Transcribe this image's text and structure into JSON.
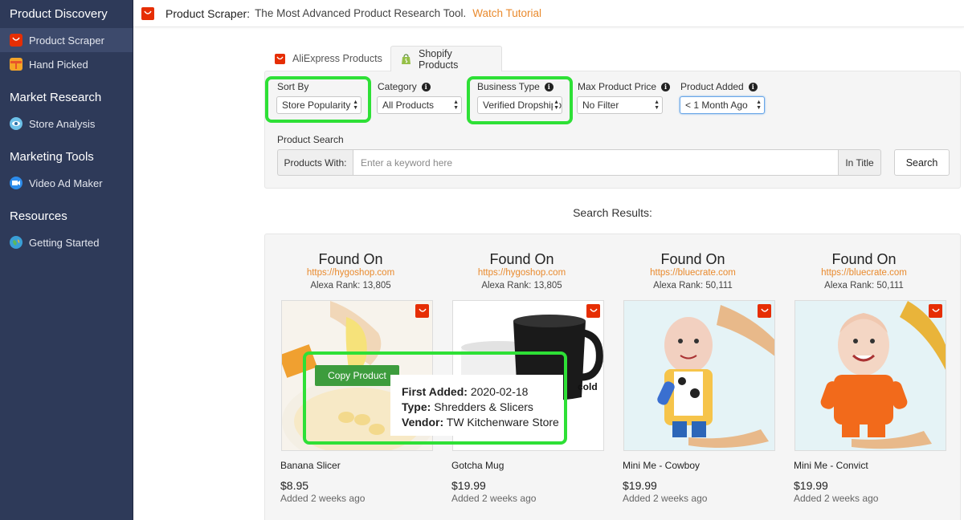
{
  "sidebar": {
    "sections": [
      {
        "heading": "Product Discovery",
        "items": [
          {
            "label": "Product Scraper",
            "icon": "aliexpress-icon",
            "active": true
          },
          {
            "label": "Hand Picked",
            "icon": "gift-icon",
            "active": false
          }
        ]
      },
      {
        "heading": "Market Research",
        "items": [
          {
            "label": "Store Analysis",
            "icon": "eye-icon",
            "active": false
          }
        ]
      },
      {
        "heading": "Marketing Tools",
        "items": [
          {
            "label": "Video Ad Maker",
            "icon": "video-camera-icon",
            "active": false
          }
        ]
      },
      {
        "heading": "Resources",
        "items": [
          {
            "label": "Getting Started",
            "icon": "globe-icon",
            "active": false
          }
        ]
      }
    ]
  },
  "topbar": {
    "title": "Product Scraper:",
    "subtitle": "The Most Advanced Product Research Tool.",
    "tutorial_link": "Watch Tutorial"
  },
  "tabs": [
    {
      "label": "AliExpress Products",
      "icon": "aliexpress-icon",
      "active": false
    },
    {
      "label": "Shopify Products",
      "icon": "shopify-bag-icon",
      "active": true
    }
  ],
  "filters": {
    "sort_by": {
      "label": "Sort By",
      "value": "Store Popularity"
    },
    "category": {
      "label": "Category",
      "value": "All Products"
    },
    "business_type": {
      "label": "Business Type",
      "value": "Verified Dropshippers"
    },
    "max_price": {
      "label": "Max Product Price",
      "value": "No Filter"
    },
    "product_added": {
      "label": "Product Added",
      "value": "< 1 Month Ago"
    }
  },
  "search": {
    "label": "Product Search",
    "prefix": "Products With:",
    "placeholder": "Enter a keyword here",
    "suffix": "In Title",
    "button": "Search"
  },
  "results_label": "Search Results:",
  "results": [
    {
      "found_on": "Found On",
      "url": "https://hygoshop.com",
      "rank": "Alexa Rank: 13,805",
      "name": "Banana Slicer",
      "price": "$8.95",
      "added": "Added 2 weeks ago"
    },
    {
      "found_on": "Found On",
      "url": "https://hygoshop.com",
      "rank": "Alexa Rank: 13,805",
      "name": "Gotcha Mug",
      "price": "$19.99",
      "added": "Added 2 weeks ago"
    },
    {
      "found_on": "Found On",
      "url": "https://bluecrate.com",
      "rank": "Alexa Rank: 50,111",
      "name": "Mini Me - Cowboy",
      "price": "$19.99",
      "added": "Added 2 weeks ago"
    },
    {
      "found_on": "Found On",
      "url": "https://bluecrate.com",
      "rank": "Alexa Rank: 50,111",
      "name": "Mini Me - Convict",
      "price": "$19.99",
      "added": "Added 2 weeks ago"
    }
  ],
  "hover": {
    "copy_button": "Copy Product",
    "first_added_label": "First Added:",
    "first_added_value": "2020-02-18",
    "type_label": "Type:",
    "type_value": "Shredders & Slicers",
    "vendor_label": "Vendor:",
    "vendor_value": "TW Kitchenware Store"
  },
  "mug_text": "cold",
  "colors": {
    "sidebar": "#2e3a59",
    "accent": "#e98a2d",
    "highlight": "#2ee036",
    "copy_button": "#3d9c3d",
    "aliexpress": "#e62e04"
  }
}
